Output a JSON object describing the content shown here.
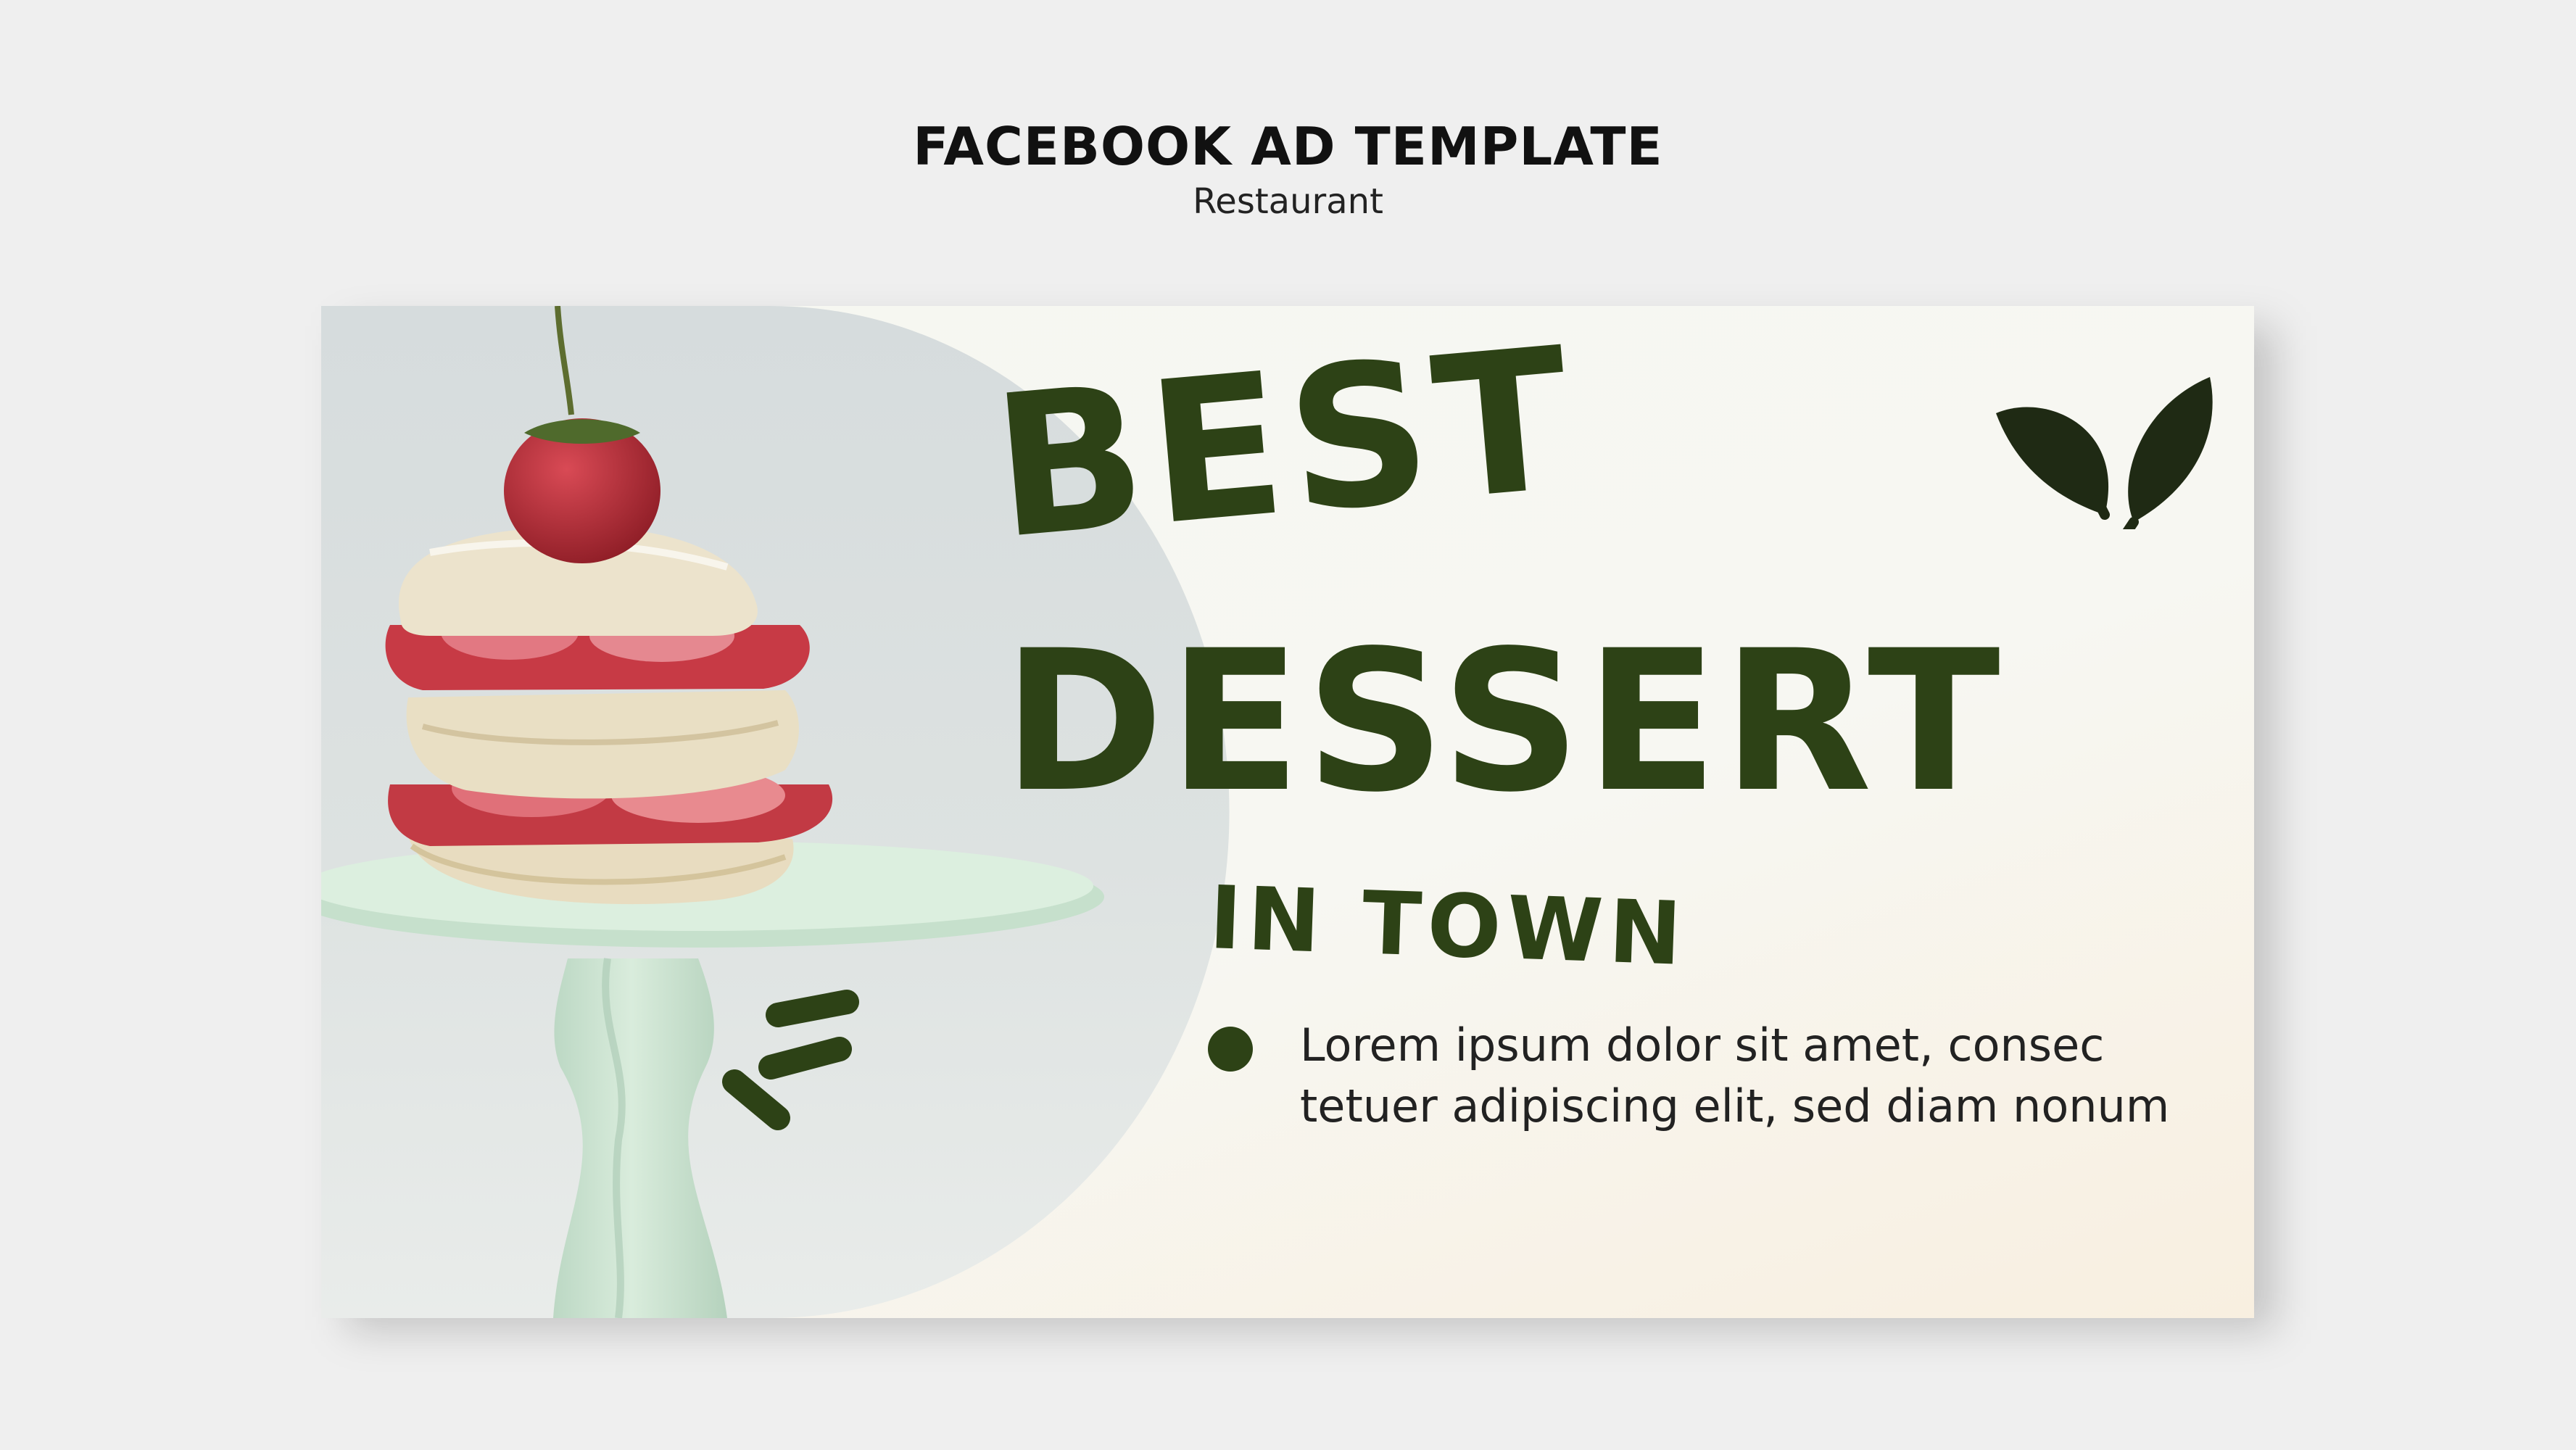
{
  "header": {
    "title": "FACEBOOK AD TEMPLATE",
    "subtitle": "Restaurant"
  },
  "ad": {
    "headline_line1": "BEST",
    "headline_line2": "DESSERT",
    "headline_line3": "IN TOWN",
    "body_text": "Lorem ipsum dolor sit amet, consec tetuer adipiscing elit, sed diam nonum",
    "colors": {
      "accent": "#2d4216",
      "leaf_icon": "#1f2a14",
      "background": "#f6f7f1",
      "page": "#efefef"
    },
    "photo_subject": "strawberry-shortcake-on-mint-cake-stand"
  }
}
